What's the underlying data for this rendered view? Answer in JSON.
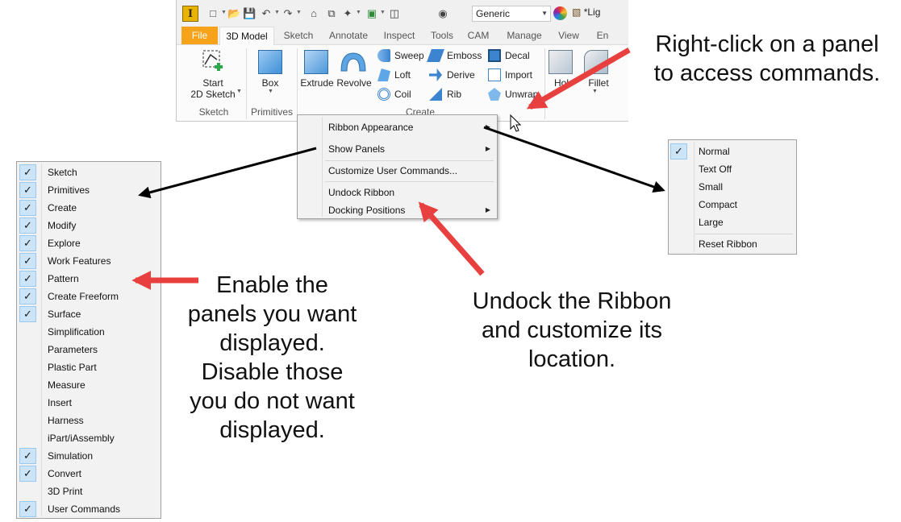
{
  "app": {
    "logo_letter": "I",
    "material": "Generic",
    "doc_title": "*Lig",
    "icons": [
      "new-icon",
      "open-icon",
      "save-icon",
      "undo-icon",
      "redo-icon",
      "home-icon",
      "copy-icon",
      "select-icon",
      "appearance-icon",
      "measure-icon",
      "material-icon",
      "color-wheel-icon",
      "document-icon"
    ]
  },
  "ribbon": {
    "tabs": [
      "File",
      "3D Model",
      "Sketch",
      "Annotate",
      "Inspect",
      "Tools",
      "CAM",
      "Manage",
      "View",
      "En"
    ],
    "active_tab": "3D Model",
    "panels": {
      "sketch": {
        "title": "Sketch",
        "start_sketch": [
          "Start",
          "2D Sketch"
        ]
      },
      "primitives": {
        "title": "Primitives",
        "box": "Box"
      },
      "create": {
        "title": "Create",
        "extrude": "Extrude",
        "revolve": "Revolve",
        "small": [
          "Sweep",
          "Emboss",
          "Decal",
          "Loft",
          "Derive",
          "Import",
          "Coil",
          "Rib",
          "Unwrap"
        ]
      },
      "modify": {
        "hole": "Hol",
        "fillet": "Fillet"
      }
    }
  },
  "context_menu": {
    "items": [
      "Ribbon Appearance",
      "Show Panels",
      "Customize User Commands...",
      "Undock Ribbon",
      "Docking Positions"
    ]
  },
  "panels_list": {
    "items": [
      {
        "label": "Sketch",
        "checked": true
      },
      {
        "label": "Primitives",
        "checked": true
      },
      {
        "label": "Create",
        "checked": true
      },
      {
        "label": "Modify",
        "checked": true
      },
      {
        "label": "Explore",
        "checked": true
      },
      {
        "label": "Work Features",
        "checked": true
      },
      {
        "label": "Pattern",
        "checked": true
      },
      {
        "label": "Create Freeform",
        "checked": true
      },
      {
        "label": "Surface",
        "checked": true
      },
      {
        "label": "Simplification",
        "checked": false
      },
      {
        "label": "Parameters",
        "checked": false
      },
      {
        "label": "Plastic Part",
        "checked": false
      },
      {
        "label": "Measure",
        "checked": false
      },
      {
        "label": "Insert",
        "checked": false
      },
      {
        "label": "Harness",
        "checked": false
      },
      {
        "label": "iPart/iAssembly",
        "checked": false
      },
      {
        "label": "Simulation",
        "checked": true
      },
      {
        "label": "Convert",
        "checked": true
      },
      {
        "label": "3D Print",
        "checked": false
      },
      {
        "label": "User Commands",
        "checked": true
      }
    ]
  },
  "appearance_menu": {
    "items": [
      {
        "label": "Normal",
        "checked": true
      },
      {
        "label": "Text Off",
        "checked": false
      },
      {
        "label": "Small",
        "checked": false
      },
      {
        "label": "Compact",
        "checked": false
      },
      {
        "label": "Large",
        "checked": false
      }
    ],
    "reset": "Reset Ribbon"
  },
  "annotations": {
    "right_click": [
      "Right-click on a panel",
      "to access commands."
    ],
    "enable": [
      "Enable the",
      "panels you want",
      "displayed.",
      "Disable those",
      "you do not want",
      "displayed."
    ],
    "undock": [
      "Undock the Ribbon",
      "and customize its",
      "location."
    ]
  },
  "colors": {
    "accent_arrow": "#e8403f",
    "black_arrow": "#000000",
    "file_tab": "#f7a21b",
    "check_bg": "#cce4f7"
  }
}
